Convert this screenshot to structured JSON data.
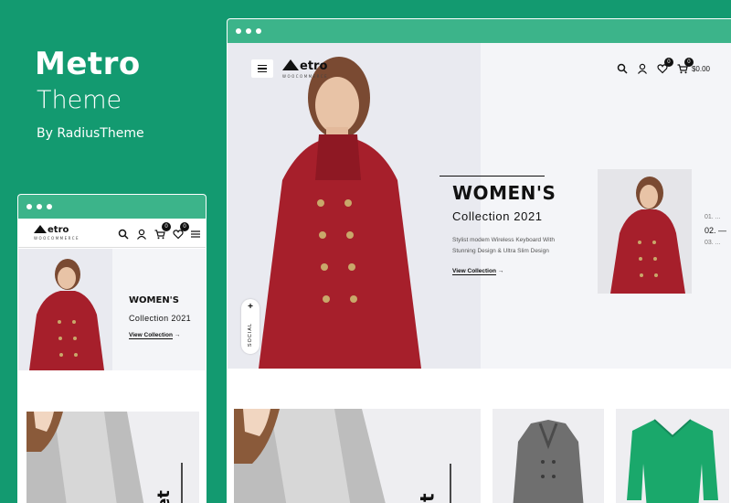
{
  "promo": {
    "title": "Metro",
    "subtitle": "Theme",
    "byline": "By RadiusTheme"
  },
  "brand": {
    "name": "etro",
    "tagline": "WOOCOMMERCE"
  },
  "desktop": {
    "cart_total": "$0.00",
    "wishlist_count": "0",
    "cart_count": "0",
    "hero": {
      "title": "WOMEN'S",
      "subtitle": "Collection 2021",
      "description": "Stylist modem Wireless Keyboard With Stunning Design & Ultra Slim Design",
      "link": "View Collection",
      "arrow": "→"
    },
    "pager": [
      "01. ...",
      "02. —",
      "03. ..."
    ],
    "social_label": "SOCIAL",
    "social_plus": "+",
    "promo_letter": "et"
  },
  "mobile": {
    "wishlist_count": "0",
    "cart_count": "0",
    "hero": {
      "title": "WOMEN'S",
      "subtitle": "Collection 2021",
      "link": "View Collection",
      "arrow": "→"
    },
    "promo_letter": "et"
  },
  "colors": {
    "background": "#139a70",
    "browser_bar": "#3cb48a",
    "coat": "#a61f2b",
    "sweater": "#1aa86b"
  }
}
